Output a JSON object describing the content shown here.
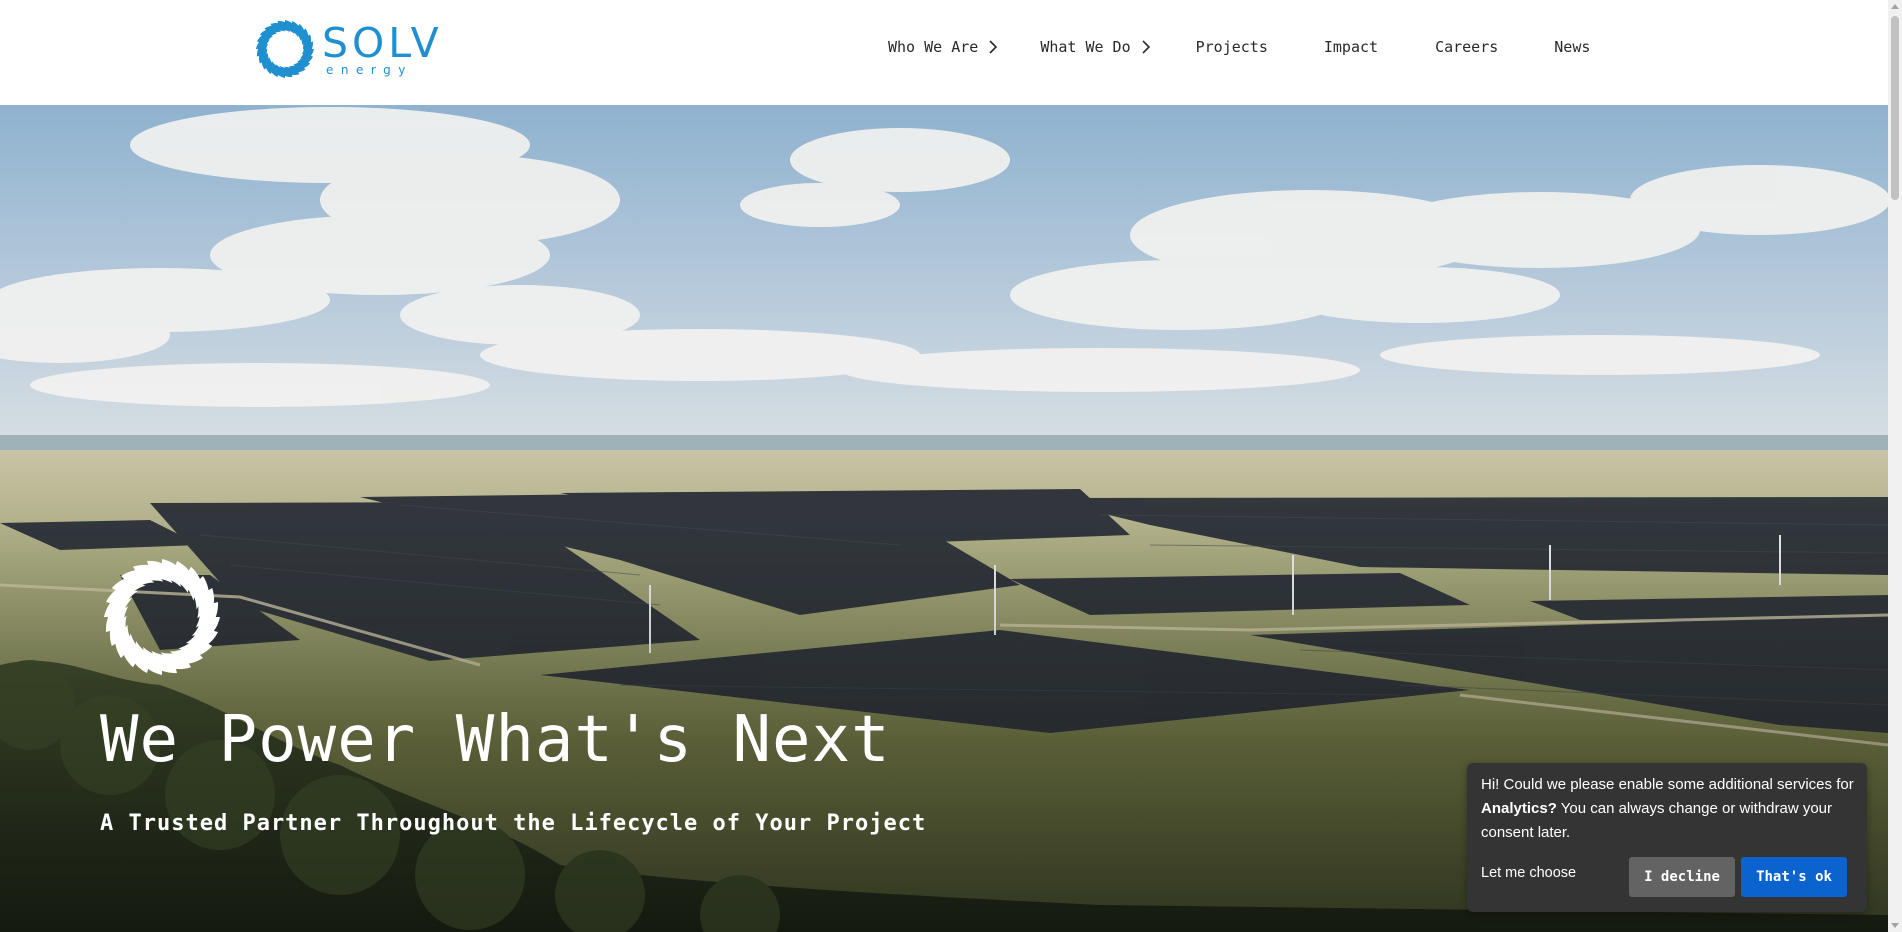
{
  "brand": {
    "name": "SOLV",
    "tagline": "energy",
    "color": "#1f8fd0"
  },
  "nav": {
    "items": [
      {
        "label": "Who We Are",
        "has_submenu": true
      },
      {
        "label": "What We Do",
        "has_submenu": true
      },
      {
        "label": "Projects",
        "has_submenu": false
      },
      {
        "label": "Impact",
        "has_submenu": false
      },
      {
        "label": "Careers",
        "has_submenu": false
      },
      {
        "label": "News",
        "has_submenu": false
      }
    ],
    "chevron_icon": "chevron-right-icon"
  },
  "hero": {
    "title": "We Power What's Next",
    "subtitle": "A Trusted Partner Throughout the Lifecycle of Your Project",
    "emblem_icon": "sunburst-icon"
  },
  "cookie_banner": {
    "text_before": "Hi! Could we please enable some additional services for ",
    "text_strong": "Analytics?",
    "text_after": " You can always change or withdraw your consent later.",
    "let_me_choose": "Let me choose",
    "decline": "I decline",
    "accept": "That's ok",
    "accept_color": "#0b63cf",
    "decline_color": "#636363",
    "background": "#343434"
  }
}
